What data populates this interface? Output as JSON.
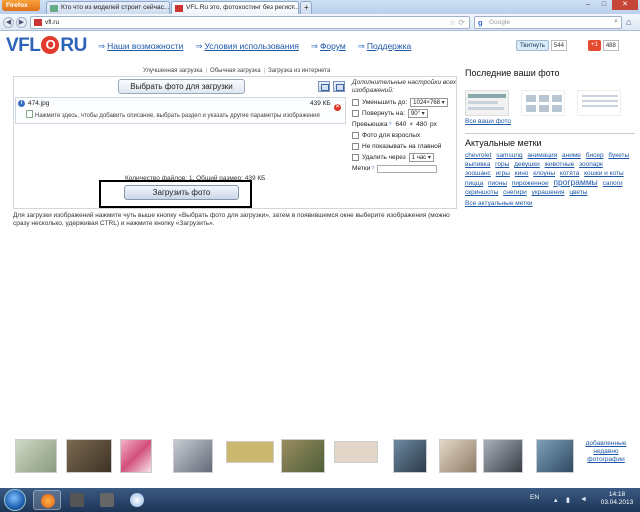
{
  "browser": {
    "app_button": "Firefox",
    "tabs": [
      {
        "label": "Кто что из моделей строит сейчас..."
      },
      {
        "label": "VFL.Ru это, фотохостинг без регист..."
      }
    ],
    "url": "vfl.ru",
    "search_placeholder": "Google"
  },
  "site": {
    "logo_left": "VFL",
    "logo_o": "O",
    "logo_right": "RU",
    "menu": [
      "Наши возможности",
      "Условия использования",
      "Форум",
      "Поддержка"
    ],
    "tweet_label": "Твитнуть",
    "tweet_count": "544",
    "gplus_label": "+1",
    "gplus_count": "488"
  },
  "upload": {
    "modes": [
      "Улучшенная загрузка",
      "Обычная загрузка",
      "Загрузка из интернета"
    ],
    "choose_button": "Выбрать фото для загрузки",
    "file": {
      "name": "474.jpg",
      "size": "439 КБ",
      "hint": "Нажмите здесь, чтобы добавить описание, выбрать раздел и указать другие параметры изображения"
    },
    "totals": "Количество файлов: 1. Общий размер: 439 КБ",
    "upload_button": "Загрузить фото",
    "options": {
      "title": "Дополнительные настройки всех изображений:",
      "resize_label": "Уменьшить до:",
      "resize_value": "1024×768",
      "rotate_label": "Повернуть на:",
      "rotate_value": "90°",
      "preview_label": "Превьюшка",
      "preview_w": "640",
      "preview_x": "×",
      "preview_h": "480",
      "preview_unit": "px",
      "adult_label": "Фото для взрослых",
      "hide_label": "Не показывать на главной",
      "delete_label": "Удалить через",
      "delete_value": "1 час",
      "tags_label": "Метки"
    },
    "instructions": "Для загрузки изображений нажмите чуть выше кнопку «Выбрать фото для загрузки», затем в появившемся окне выберите изображения (можно сразу несколько, удерживая CTRL) и нажмите кнопку «Загрузить»."
  },
  "sidebar": {
    "recent_title": "Последние ваши фото",
    "all_photos": "Все ваши фото",
    "tags_title": "Актуальные метки",
    "tags": [
      "chevrolet",
      "samsung",
      "анимация",
      "аниме",
      "бисер",
      "букеты",
      "выпивка",
      "горы",
      "девушки",
      "животные",
      "зоопарк",
      "зоошанс",
      "игры",
      "кино",
      "клоуны",
      "котята",
      "кошки и коты",
      "пицца",
      "пионы",
      "пироженное",
      "программы",
      "сапоги",
      "скриншоты",
      "снегири",
      "украшения",
      "цветы"
    ],
    "all_tags": "Все актуальные метки"
  },
  "footer": {
    "more_photos": "добавленные недавно фотографии"
  },
  "taskbar": {
    "lang": "EN",
    "time": "14:18",
    "date": "03.04.2013"
  }
}
